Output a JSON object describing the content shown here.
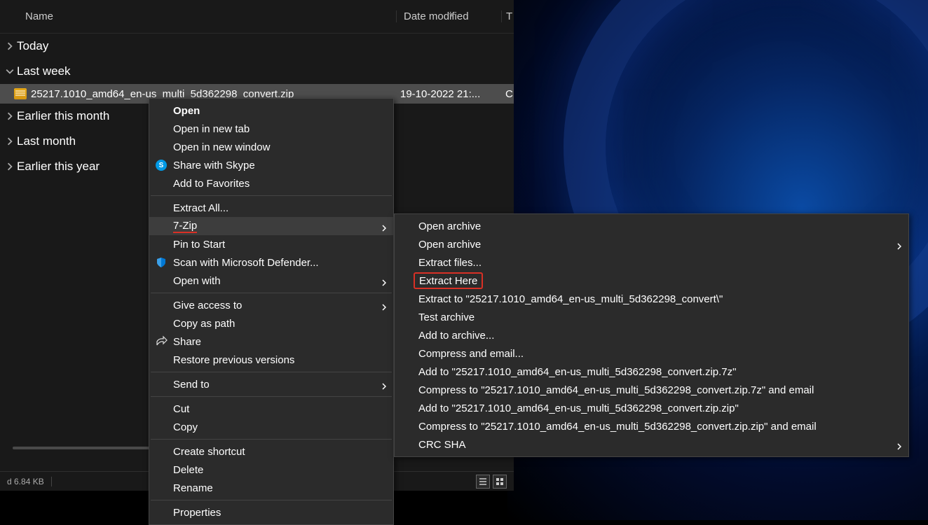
{
  "columns": {
    "name": "Name",
    "date": "Date modified",
    "type": "T"
  },
  "groups": {
    "today": "Today",
    "lastweek": "Last week",
    "earliermonth": "Earlier this month",
    "lastmonth": "Last month",
    "earlieryear": "Earlier this year"
  },
  "file": {
    "name": "25217.1010_amd64_en-us_multi_5d362298_convert.zip",
    "date": "19-10-2022 21:...",
    "typecol": "C"
  },
  "menu1": {
    "open": "Open",
    "opentab": "Open in new tab",
    "openwindow": "Open in new window",
    "skype": "Share with Skype",
    "favorites": "Add to Favorites",
    "extractall": "Extract All...",
    "sevenzip": "7-Zip",
    "pinstart": "Pin to Start",
    "defender": "Scan with Microsoft Defender...",
    "openwith": "Open with",
    "giveaccess": "Give access to",
    "copypath": "Copy as path",
    "share": "Share",
    "restore": "Restore previous versions",
    "sendto": "Send to",
    "cut": "Cut",
    "copy": "Copy",
    "shortcut": "Create shortcut",
    "delete": "Delete",
    "rename": "Rename",
    "properties": "Properties"
  },
  "menu2": {
    "openarchive1": "Open archive",
    "openarchive2": "Open archive",
    "extractfiles": "Extract files...",
    "extracthere": "Extract Here",
    "extractto": "Extract to \"25217.1010_amd64_en-us_multi_5d362298_convert\\\"",
    "testarchive": "Test archive",
    "addtoarchive": "Add to archive...",
    "compressemail": "Compress and email...",
    "addto7z": "Add to \"25217.1010_amd64_en-us_multi_5d362298_convert.zip.7z\"",
    "compress7zemail": "Compress to \"25217.1010_amd64_en-us_multi_5d362298_convert.zip.7z\" and email",
    "addtozip": "Add to \"25217.1010_amd64_en-us_multi_5d362298_convert.zip.zip\"",
    "compresszipemail": "Compress to \"25217.1010_amd64_en-us_multi_5d362298_convert.zip.zip\" and email",
    "crcsha": "CRC SHA"
  },
  "status": {
    "size": "d 6.84 KB"
  }
}
